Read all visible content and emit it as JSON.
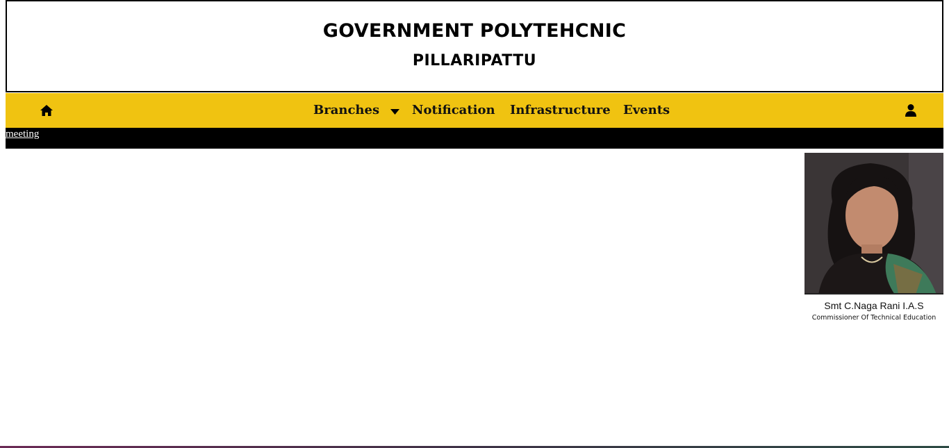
{
  "header": {
    "title": "GOVERNMENT POLYTEHCNIC",
    "subtitle": "PILLARIPATTU"
  },
  "navbar": {
    "background": "#f0c311",
    "home_icon": "home-icon",
    "user_icon": "user-icon",
    "items": [
      {
        "label": "Branches",
        "has_dropdown": true
      },
      {
        "label": "Notification"
      },
      {
        "label": "Infrastructure"
      },
      {
        "label": "Events"
      }
    ]
  },
  "ticker": {
    "text": "meeting"
  },
  "profile": {
    "name": "Smt C.Naga Rani I.A.S",
    "role": "Commissioner Of Technical Education"
  }
}
